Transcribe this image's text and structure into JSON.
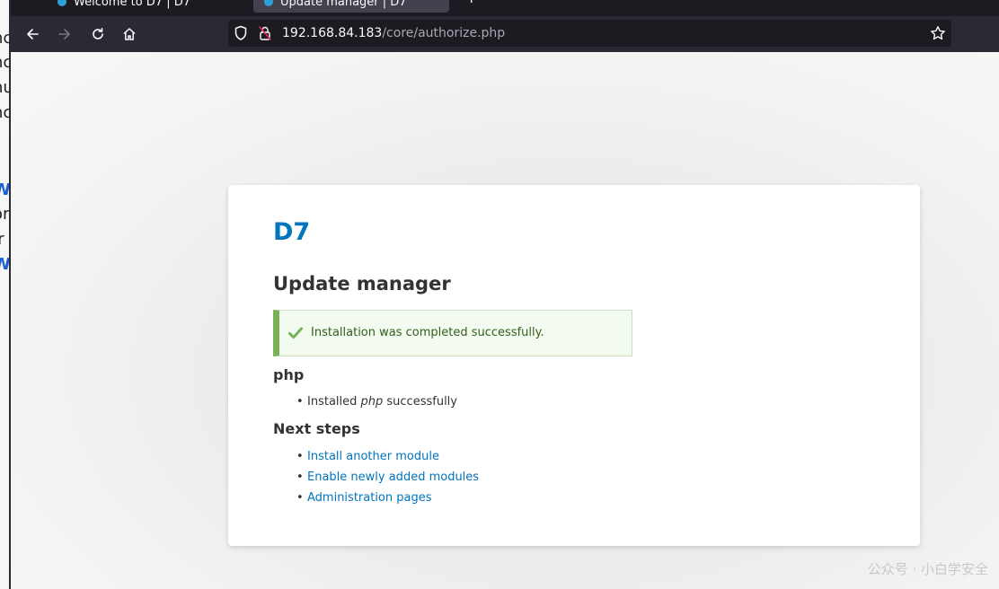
{
  "background_window": {
    "fragments": [
      "-",
      "nc",
      "nc",
      "nu",
      "nc",
      "-",
      "W",
      "or",
      "Ir",
      "W"
    ]
  },
  "tabs": [
    {
      "label": "Welcome to D7 | D7"
    },
    {
      "label": "Update manager | D7"
    }
  ],
  "new_tab_label": "+",
  "url": {
    "host": "192.168.84.183",
    "path": "/core/authorize.php"
  },
  "page": {
    "site_name": "D7",
    "title": "Update manager",
    "status_message": "Installation was completed successfully.",
    "project_heading": "php",
    "project_results": [
      {
        "before": "Installed ",
        "emphasis": "php",
        "after": " successfully"
      }
    ],
    "next_steps_heading": "Next steps",
    "next_steps": [
      "Install another module",
      "Enable newly added modules",
      "Administration pages"
    ]
  },
  "watermark": "公众号 · 小白学安全",
  "colors": {
    "link": "#0074bd",
    "status_border": "#77b259",
    "status_bg": "#f3faef"
  }
}
